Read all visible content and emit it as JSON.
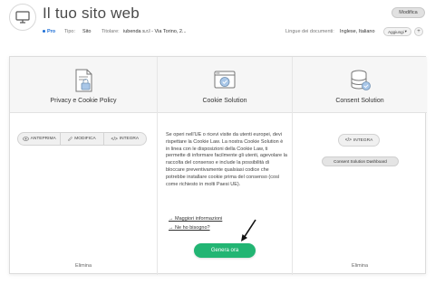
{
  "header": {
    "title": "Il tuo sito web",
    "modifica_label": "Modifica",
    "plan": "Pro",
    "tipo_label": "Tipo:",
    "tipo_value": "Sito",
    "titolare_label": "Titolare:",
    "titolare_value": "iubenda s.r.l - Via Torino, 2...",
    "lingue_label": "Lingue dei documenti:",
    "lingue_value": "Inglese, Italiano",
    "aggiungi_label": "Aggiungi",
    "add_symbol": "+"
  },
  "columns": [
    {
      "title": "Privacy e Cookie Policy",
      "buttons": [
        "ANTEPRIMA",
        "MODIFICA",
        "INTEGRA"
      ],
      "elimina": "Elimina"
    },
    {
      "title": "Cookie Solution",
      "description": "Se operi nell'UE o ricevi visite da utenti europei, devi rispettare la Cookie Law. La nostra Cookie Solution è in linea con le disposizioni della Cookie Law, ti permette di informare facilmente gli utenti, agevolare la raccolta del consenso e include la possibilità di bloccare preventivamente qualsiasi codice che potrebbe installare cookie prima del consenso (così come richiesto in molti Paesi UE).",
      "links": [
        "→ Maggiori informazioni",
        "→ Ne ho bisogno?"
      ],
      "cta": "Genera ora"
    },
    {
      "title": "Consent Solution",
      "integra_label": "INTEGRA",
      "dashboard_label": "Consent Solution Dashboard",
      "elimina": "Elimina"
    }
  ],
  "colors": {
    "accent_green": "#22b573",
    "pro_blue": "#1e6fd6"
  }
}
